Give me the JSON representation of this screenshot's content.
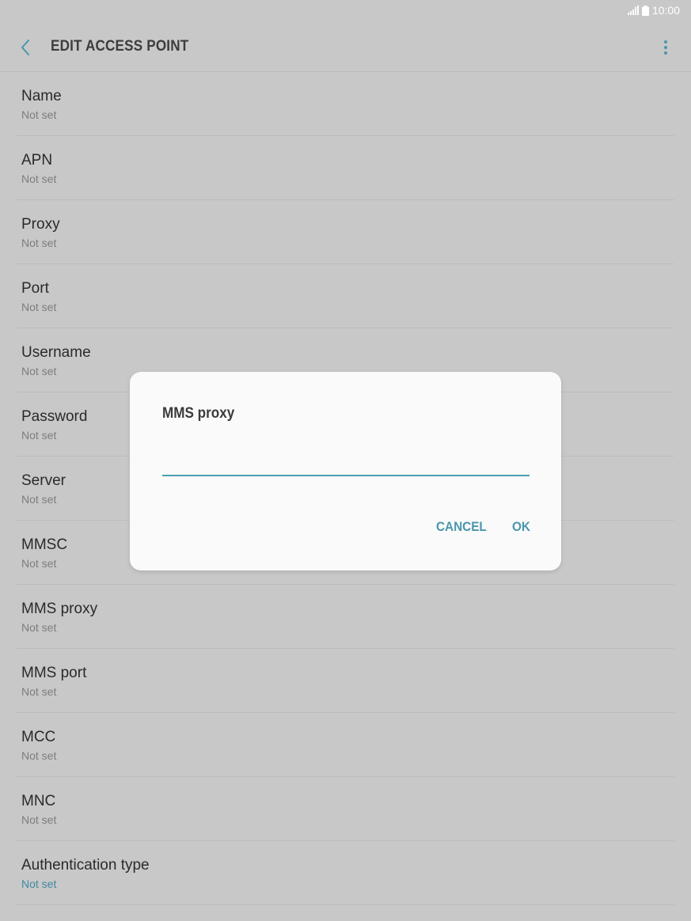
{
  "status_bar": {
    "time": "10:00"
  },
  "header": {
    "title": "EDIT ACCESS POINT"
  },
  "settings": [
    {
      "title": "Name",
      "value": "Not set"
    },
    {
      "title": "APN",
      "value": "Not set"
    },
    {
      "title": "Proxy",
      "value": "Not set"
    },
    {
      "title": "Port",
      "value": "Not set"
    },
    {
      "title": "Username",
      "value": "Not set"
    },
    {
      "title": "Password",
      "value": "Not set"
    },
    {
      "title": "Server",
      "value": "Not set"
    },
    {
      "title": "MMSC",
      "value": "Not set"
    },
    {
      "title": "MMS proxy",
      "value": "Not set"
    },
    {
      "title": "MMS port",
      "value": "Not set"
    },
    {
      "title": "MCC",
      "value": "Not set"
    },
    {
      "title": "MNC",
      "value": "Not set"
    },
    {
      "title": "Authentication type",
      "value": "Not set"
    }
  ],
  "dialog": {
    "title": "MMS proxy",
    "input_value": "",
    "cancel_label": "CANCEL",
    "ok_label": "OK"
  },
  "colors": {
    "background": "#c8c8c8",
    "dialog_background": "#fafafa",
    "accent": "#4a96ac"
  },
  "icons": {
    "back": "back-chevron-icon",
    "more": "more-vert-icon",
    "signal": "signal-icon",
    "battery": "battery-icon"
  }
}
